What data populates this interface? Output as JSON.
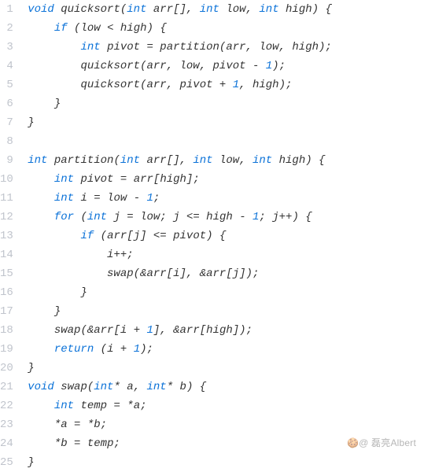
{
  "code": {
    "language": "c",
    "lines": [
      {
        "n": 1,
        "indent": 0,
        "tokens": [
          [
            "kw",
            "void"
          ],
          [
            "sp",
            " "
          ],
          [
            "id",
            "quicksort"
          ],
          [
            "pn",
            "("
          ],
          [
            "kw",
            "int"
          ],
          [
            "sp",
            " "
          ],
          [
            "id",
            "arr"
          ],
          [
            "pn",
            "[]"
          ],
          [
            "pn",
            ","
          ],
          [
            "sp",
            " "
          ],
          [
            "kw",
            "int"
          ],
          [
            "sp",
            " "
          ],
          [
            "id",
            "low"
          ],
          [
            "pn",
            ","
          ],
          [
            "sp",
            " "
          ],
          [
            "kw",
            "int"
          ],
          [
            "sp",
            " "
          ],
          [
            "id",
            "high"
          ],
          [
            "pn",
            ")"
          ],
          [
            "sp",
            " "
          ],
          [
            "pn",
            "{"
          ]
        ]
      },
      {
        "n": 2,
        "indent": 1,
        "tokens": [
          [
            "kw",
            "if"
          ],
          [
            "sp",
            " "
          ],
          [
            "pn",
            "("
          ],
          [
            "id",
            "low"
          ],
          [
            "sp",
            " "
          ],
          [
            "op",
            "<"
          ],
          [
            "sp",
            " "
          ],
          [
            "id",
            "high"
          ],
          [
            "pn",
            ")"
          ],
          [
            "sp",
            " "
          ],
          [
            "pn",
            "{"
          ]
        ]
      },
      {
        "n": 3,
        "indent": 2,
        "tokens": [
          [
            "kw",
            "int"
          ],
          [
            "sp",
            " "
          ],
          [
            "id",
            "pivot"
          ],
          [
            "sp",
            " "
          ],
          [
            "op",
            "="
          ],
          [
            "sp",
            " "
          ],
          [
            "id",
            "partition"
          ],
          [
            "pn",
            "("
          ],
          [
            "id",
            "arr"
          ],
          [
            "pn",
            ","
          ],
          [
            "sp",
            " "
          ],
          [
            "id",
            "low"
          ],
          [
            "pn",
            ","
          ],
          [
            "sp",
            " "
          ],
          [
            "id",
            "high"
          ],
          [
            "pn",
            ")"
          ],
          [
            "pn",
            ";"
          ]
        ]
      },
      {
        "n": 4,
        "indent": 2,
        "tokens": [
          [
            "id",
            "quicksort"
          ],
          [
            "pn",
            "("
          ],
          [
            "id",
            "arr"
          ],
          [
            "pn",
            ","
          ],
          [
            "sp",
            " "
          ],
          [
            "id",
            "low"
          ],
          [
            "pn",
            ","
          ],
          [
            "sp",
            " "
          ],
          [
            "id",
            "pivot"
          ],
          [
            "sp",
            " "
          ],
          [
            "op",
            "-"
          ],
          [
            "sp",
            " "
          ],
          [
            "num",
            "1"
          ],
          [
            "pn",
            ")"
          ],
          [
            "pn",
            ";"
          ]
        ]
      },
      {
        "n": 5,
        "indent": 2,
        "tokens": [
          [
            "id",
            "quicksort"
          ],
          [
            "pn",
            "("
          ],
          [
            "id",
            "arr"
          ],
          [
            "pn",
            ","
          ],
          [
            "sp",
            " "
          ],
          [
            "id",
            "pivot"
          ],
          [
            "sp",
            " "
          ],
          [
            "op",
            "+"
          ],
          [
            "sp",
            " "
          ],
          [
            "num",
            "1"
          ],
          [
            "pn",
            ","
          ],
          [
            "sp",
            " "
          ],
          [
            "id",
            "high"
          ],
          [
            "pn",
            ")"
          ],
          [
            "pn",
            ";"
          ]
        ]
      },
      {
        "n": 6,
        "indent": 1,
        "tokens": [
          [
            "pn",
            "}"
          ]
        ]
      },
      {
        "n": 7,
        "indent": 0,
        "tokens": [
          [
            "pn",
            "}"
          ]
        ]
      },
      {
        "n": 8,
        "indent": 0,
        "tokens": []
      },
      {
        "n": 9,
        "indent": 0,
        "tokens": [
          [
            "kw",
            "int"
          ],
          [
            "sp",
            " "
          ],
          [
            "id",
            "partition"
          ],
          [
            "pn",
            "("
          ],
          [
            "kw",
            "int"
          ],
          [
            "sp",
            " "
          ],
          [
            "id",
            "arr"
          ],
          [
            "pn",
            "[]"
          ],
          [
            "pn",
            ","
          ],
          [
            "sp",
            " "
          ],
          [
            "kw",
            "int"
          ],
          [
            "sp",
            " "
          ],
          [
            "id",
            "low"
          ],
          [
            "pn",
            ","
          ],
          [
            "sp",
            " "
          ],
          [
            "kw",
            "int"
          ],
          [
            "sp",
            " "
          ],
          [
            "id",
            "high"
          ],
          [
            "pn",
            ")"
          ],
          [
            "sp",
            " "
          ],
          [
            "pn",
            "{"
          ]
        ]
      },
      {
        "n": 10,
        "indent": 1,
        "tokens": [
          [
            "kw",
            "int"
          ],
          [
            "sp",
            " "
          ],
          [
            "id",
            "pivot"
          ],
          [
            "sp",
            " "
          ],
          [
            "op",
            "="
          ],
          [
            "sp",
            " "
          ],
          [
            "id",
            "arr"
          ],
          [
            "pn",
            "["
          ],
          [
            "id",
            "high"
          ],
          [
            "pn",
            "]"
          ],
          [
            "pn",
            ";"
          ]
        ]
      },
      {
        "n": 11,
        "indent": 1,
        "tokens": [
          [
            "kw",
            "int"
          ],
          [
            "sp",
            " "
          ],
          [
            "id",
            "i"
          ],
          [
            "sp",
            " "
          ],
          [
            "op",
            "="
          ],
          [
            "sp",
            " "
          ],
          [
            "id",
            "low"
          ],
          [
            "sp",
            " "
          ],
          [
            "op",
            "-"
          ],
          [
            "sp",
            " "
          ],
          [
            "num",
            "1"
          ],
          [
            "pn",
            ";"
          ]
        ]
      },
      {
        "n": 12,
        "indent": 1,
        "tokens": [
          [
            "kw",
            "for"
          ],
          [
            "sp",
            " "
          ],
          [
            "pn",
            "("
          ],
          [
            "kw",
            "int"
          ],
          [
            "sp",
            " "
          ],
          [
            "id",
            "j"
          ],
          [
            "sp",
            " "
          ],
          [
            "op",
            "="
          ],
          [
            "sp",
            " "
          ],
          [
            "id",
            "low"
          ],
          [
            "pn",
            ";"
          ],
          [
            "sp",
            " "
          ],
          [
            "id",
            "j"
          ],
          [
            "sp",
            " "
          ],
          [
            "op",
            "<="
          ],
          [
            "sp",
            " "
          ],
          [
            "id",
            "high"
          ],
          [
            "sp",
            " "
          ],
          [
            "op",
            "-"
          ],
          [
            "sp",
            " "
          ],
          [
            "num",
            "1"
          ],
          [
            "pn",
            ";"
          ],
          [
            "sp",
            " "
          ],
          [
            "id",
            "j"
          ],
          [
            "op",
            "++"
          ],
          [
            "pn",
            ")"
          ],
          [
            "sp",
            " "
          ],
          [
            "pn",
            "{"
          ]
        ]
      },
      {
        "n": 13,
        "indent": 2,
        "tokens": [
          [
            "kw",
            "if"
          ],
          [
            "sp",
            " "
          ],
          [
            "pn",
            "("
          ],
          [
            "id",
            "arr"
          ],
          [
            "pn",
            "["
          ],
          [
            "id",
            "j"
          ],
          [
            "pn",
            "]"
          ],
          [
            "sp",
            " "
          ],
          [
            "op",
            "<="
          ],
          [
            "sp",
            " "
          ],
          [
            "id",
            "pivot"
          ],
          [
            "pn",
            ")"
          ],
          [
            "sp",
            " "
          ],
          [
            "pn",
            "{"
          ]
        ]
      },
      {
        "n": 14,
        "indent": 3,
        "tokens": [
          [
            "id",
            "i"
          ],
          [
            "op",
            "++"
          ],
          [
            "pn",
            ";"
          ]
        ]
      },
      {
        "n": 15,
        "indent": 3,
        "tokens": [
          [
            "id",
            "swap"
          ],
          [
            "pn",
            "("
          ],
          [
            "op",
            "&"
          ],
          [
            "id",
            "arr"
          ],
          [
            "pn",
            "["
          ],
          [
            "id",
            "i"
          ],
          [
            "pn",
            "]"
          ],
          [
            "pn",
            ","
          ],
          [
            "sp",
            " "
          ],
          [
            "op",
            "&"
          ],
          [
            "id",
            "arr"
          ],
          [
            "pn",
            "["
          ],
          [
            "id",
            "j"
          ],
          [
            "pn",
            "]"
          ],
          [
            "pn",
            ")"
          ],
          [
            "pn",
            ";"
          ]
        ]
      },
      {
        "n": 16,
        "indent": 2,
        "tokens": [
          [
            "pn",
            "}"
          ]
        ]
      },
      {
        "n": 17,
        "indent": 1,
        "tokens": [
          [
            "pn",
            "}"
          ]
        ]
      },
      {
        "n": 18,
        "indent": 1,
        "tokens": [
          [
            "id",
            "swap"
          ],
          [
            "pn",
            "("
          ],
          [
            "op",
            "&"
          ],
          [
            "id",
            "arr"
          ],
          [
            "pn",
            "["
          ],
          [
            "id",
            "i"
          ],
          [
            "sp",
            " "
          ],
          [
            "op",
            "+"
          ],
          [
            "sp",
            " "
          ],
          [
            "num",
            "1"
          ],
          [
            "pn",
            "]"
          ],
          [
            "pn",
            ","
          ],
          [
            "sp",
            " "
          ],
          [
            "op",
            "&"
          ],
          [
            "id",
            "arr"
          ],
          [
            "pn",
            "["
          ],
          [
            "id",
            "high"
          ],
          [
            "pn",
            "]"
          ],
          [
            "pn",
            ")"
          ],
          [
            "pn",
            ";"
          ]
        ]
      },
      {
        "n": 19,
        "indent": 1,
        "tokens": [
          [
            "kw",
            "return"
          ],
          [
            "sp",
            " "
          ],
          [
            "pn",
            "("
          ],
          [
            "id",
            "i"
          ],
          [
            "sp",
            " "
          ],
          [
            "op",
            "+"
          ],
          [
            "sp",
            " "
          ],
          [
            "num",
            "1"
          ],
          [
            "pn",
            ")"
          ],
          [
            "pn",
            ";"
          ]
        ]
      },
      {
        "n": 20,
        "indent": 0,
        "tokens": [
          [
            "pn",
            "}"
          ]
        ]
      },
      {
        "n": 21,
        "indent": 0,
        "tokens": [
          [
            "kw",
            "void"
          ],
          [
            "sp",
            " "
          ],
          [
            "id",
            "swap"
          ],
          [
            "pn",
            "("
          ],
          [
            "kw",
            "int"
          ],
          [
            "op",
            "*"
          ],
          [
            "sp",
            " "
          ],
          [
            "id",
            "a"
          ],
          [
            "pn",
            ","
          ],
          [
            "sp",
            " "
          ],
          [
            "kw",
            "int"
          ],
          [
            "op",
            "*"
          ],
          [
            "sp",
            " "
          ],
          [
            "id",
            "b"
          ],
          [
            "pn",
            ")"
          ],
          [
            "sp",
            " "
          ],
          [
            "pn",
            "{"
          ]
        ]
      },
      {
        "n": 22,
        "indent": 1,
        "tokens": [
          [
            "kw",
            "int"
          ],
          [
            "sp",
            " "
          ],
          [
            "id",
            "temp"
          ],
          [
            "sp",
            " "
          ],
          [
            "op",
            "="
          ],
          [
            "sp",
            " "
          ],
          [
            "op",
            "*"
          ],
          [
            "id",
            "a"
          ],
          [
            "pn",
            ";"
          ]
        ]
      },
      {
        "n": 23,
        "indent": 1,
        "tokens": [
          [
            "op",
            "*"
          ],
          [
            "id",
            "a"
          ],
          [
            "sp",
            " "
          ],
          [
            "op",
            "="
          ],
          [
            "sp",
            " "
          ],
          [
            "op",
            "*"
          ],
          [
            "id",
            "b"
          ],
          [
            "pn",
            ";"
          ]
        ]
      },
      {
        "n": 24,
        "indent": 1,
        "tokens": [
          [
            "op",
            "*"
          ],
          [
            "id",
            "b"
          ],
          [
            "sp",
            " "
          ],
          [
            "op",
            "="
          ],
          [
            "sp",
            " "
          ],
          [
            "id",
            "temp"
          ],
          [
            "pn",
            ";"
          ]
        ]
      },
      {
        "n": 25,
        "indent": 0,
        "tokens": [
          [
            "pn",
            "}"
          ]
        ]
      }
    ]
  },
  "watermark": "🍪@ 磊亮Albert",
  "style": {
    "keyword_color": "#0b72d8",
    "number_color": "#0b72d8",
    "text_color": "#333333",
    "gutter_color": "#c0c4cc",
    "indent_unit": "    "
  }
}
